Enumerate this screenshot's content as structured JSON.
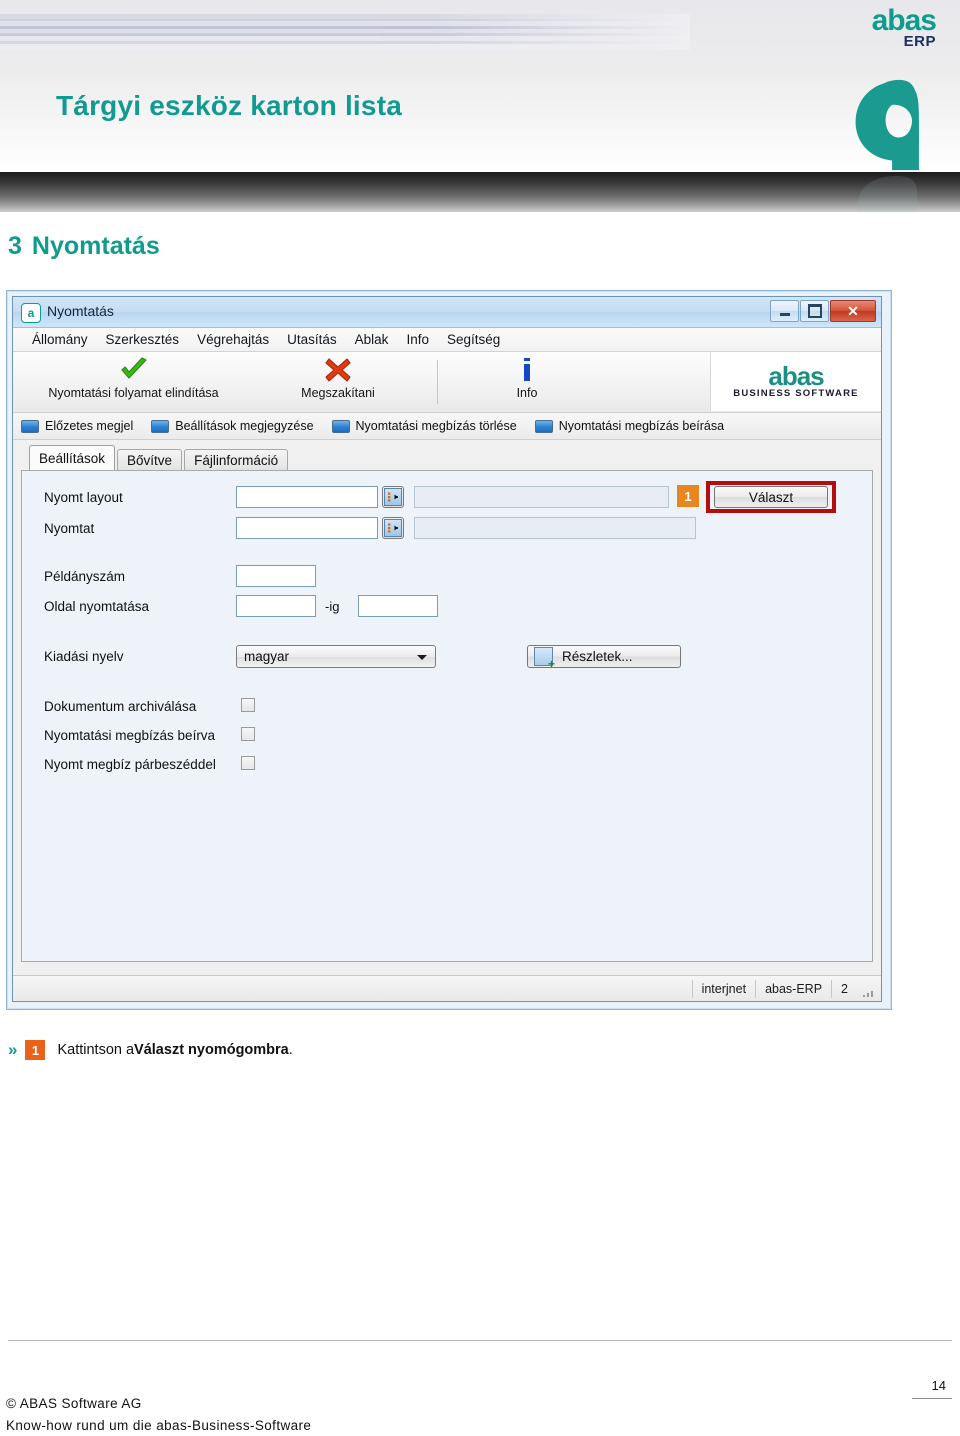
{
  "banner": {
    "title": "Tárgyi eszköz karton lista",
    "logo_word": "abas",
    "logo_sub": "ERP",
    "title_color": "#119a90"
  },
  "section": {
    "number": "3",
    "title": "Nyomtatás"
  },
  "dialog": {
    "window_title": "Nyomtatás",
    "app_icon": "a",
    "window_buttons": {
      "minimize": "minimize-icon",
      "maximize": "maximize-icon",
      "close": "✕"
    },
    "menu": [
      "Állomány",
      "Szerkesztés",
      "Végrehajtás",
      "Utasítás",
      "Ablak",
      "Info",
      "Segítség"
    ],
    "toolbar": [
      {
        "label": "Nyomtatási folyamat elindítása",
        "icon": "check-icon",
        "color": "#3cb518"
      },
      {
        "label": "Megszakítani",
        "icon": "cross-icon",
        "color": "#e03a12"
      },
      {
        "label": "Info",
        "icon": "info-icon",
        "color": "#1448c8"
      }
    ],
    "toolbar_logo": {
      "word": "abas",
      "sub": "BUSINESS SOFTWARE"
    },
    "toggles": [
      "Előzetes megjel",
      "Beállítások megjegyzése",
      "Nyomtatási megbízás törlése",
      "Nyomtatási megbízás beírása"
    ],
    "tabs": [
      {
        "label": "Beállítások",
        "active": true
      },
      {
        "label": "Bővítve",
        "active": false
      },
      {
        "label": "Fájlinformáció",
        "active": false
      }
    ],
    "form": {
      "nyomt_layout_label": "Nyomt layout",
      "nyomt_layout_value": "",
      "nyomt_layout_desc": "",
      "nyomtat_label": "Nyomtat",
      "nyomtat_value": "",
      "nyomtat_desc": "",
      "peldanyszam_label": "Példányszám",
      "peldanyszam_value": "",
      "oldal_label": "Oldal nyomtatása",
      "oldal_from_value": "",
      "oldal_sep": "-ig",
      "oldal_to_value": "",
      "kiadasi_nyelv_label": "Kiadási nyelv",
      "kiadasi_nyelv_value": "magyar",
      "reszletek_button": "Részletek...",
      "valaszt_button": "Választ",
      "valaszt_badge": "1",
      "checkboxes": [
        {
          "label": "Dokumentum archiválása",
          "checked": false
        },
        {
          "label": "Nyomtatási megbízás beírva",
          "checked": false
        },
        {
          "label": "Nyomt megbíz párbeszéddel",
          "checked": false
        }
      ]
    },
    "statusbar": [
      "interjnet",
      "abas-ERP",
      "2"
    ]
  },
  "caption": {
    "chevron": "»",
    "badge": "1",
    "text_before": "Kattintson  a ",
    "text_bold": "Választ nyomógombra",
    "text_after": "."
  },
  "footer": {
    "page_number": "14",
    "line1": "© ABAS  Software  AG",
    "line2": "Know-how  rund  um  die  abas-Business-Software"
  },
  "colors": {
    "brand_teal": "#0f9b8e",
    "accent_orange": "#e8621a",
    "highlight_red": "#b50d0d"
  }
}
